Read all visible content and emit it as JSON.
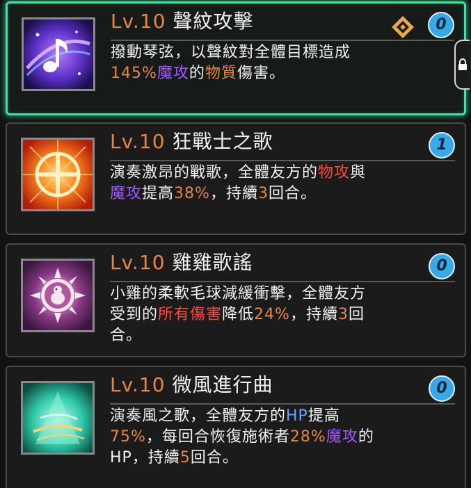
{
  "skills": [
    {
      "level": "Lv.10",
      "name": "聲紋攻擊",
      "count": "0",
      "desc": [
        {
          "t": "撥動琴弦，以聲紋對全體目標造成"
        },
        {
          "br": true
        },
        {
          "t": "145%",
          "c": "orange"
        },
        {
          "t": "魔攻",
          "c": "purple"
        },
        {
          "t": "的"
        },
        {
          "t": "物質",
          "c": "orange"
        },
        {
          "t": "傷害。"
        }
      ]
    },
    {
      "level": "Lv.10",
      "name": "狂戰士之歌",
      "count": "1",
      "desc": [
        {
          "t": "演奏激昂的戰歌，全體友方的"
        },
        {
          "t": "物攻",
          "c": "red"
        },
        {
          "t": "與"
        },
        {
          "br": true
        },
        {
          "t": "魔攻",
          "c": "purple"
        },
        {
          "t": "提高"
        },
        {
          "t": "38%",
          "c": "orange"
        },
        {
          "t": "，持續"
        },
        {
          "t": "3",
          "c": "orange"
        },
        {
          "t": "回合。"
        }
      ]
    },
    {
      "level": "Lv.10",
      "name": "雞雞歌謠",
      "count": "0",
      "desc": [
        {
          "t": "小雞的柔軟毛球減緩衝擊，全體友方"
        },
        {
          "br": true
        },
        {
          "t": "受到的"
        },
        {
          "t": "所有傷害",
          "c": "red"
        },
        {
          "t": "降低"
        },
        {
          "t": "24%",
          "c": "orange"
        },
        {
          "t": "，持續"
        },
        {
          "t": "3",
          "c": "orange"
        },
        {
          "t": "回"
        },
        {
          "br": true
        },
        {
          "t": "合。"
        }
      ]
    },
    {
      "level": "Lv.10",
      "name": "微風進行曲",
      "count": "0",
      "desc": [
        {
          "t": "演奏風之歌，全體友方的"
        },
        {
          "t": "HP",
          "c": "blue"
        },
        {
          "t": "提高"
        },
        {
          "br": true
        },
        {
          "t": "75%",
          "c": "orange"
        },
        {
          "t": "，每回合恢復施術者"
        },
        {
          "t": "28%",
          "c": "orange"
        },
        {
          "t": "魔攻",
          "c": "purple"
        },
        {
          "t": "的"
        },
        {
          "br": true
        },
        {
          "t": "HP，持續"
        },
        {
          "t": "5",
          "c": "orange"
        },
        {
          "t": "回合。"
        }
      ]
    }
  ],
  "colors": {
    "level": "#e9863f",
    "accent_orange": "#e9863f",
    "accent_purple": "#a357ff",
    "accent_red": "#ff4a3d",
    "accent_blue": "#6da2ff",
    "selected_border": "#37e6a3",
    "badge": "#37a9e6"
  },
  "icons": [
    "music-note-icon",
    "sun-cross-icon",
    "chick-sun-icon",
    "wind-tree-icon",
    "equip-diamond-icon",
    "lock-icon"
  ]
}
